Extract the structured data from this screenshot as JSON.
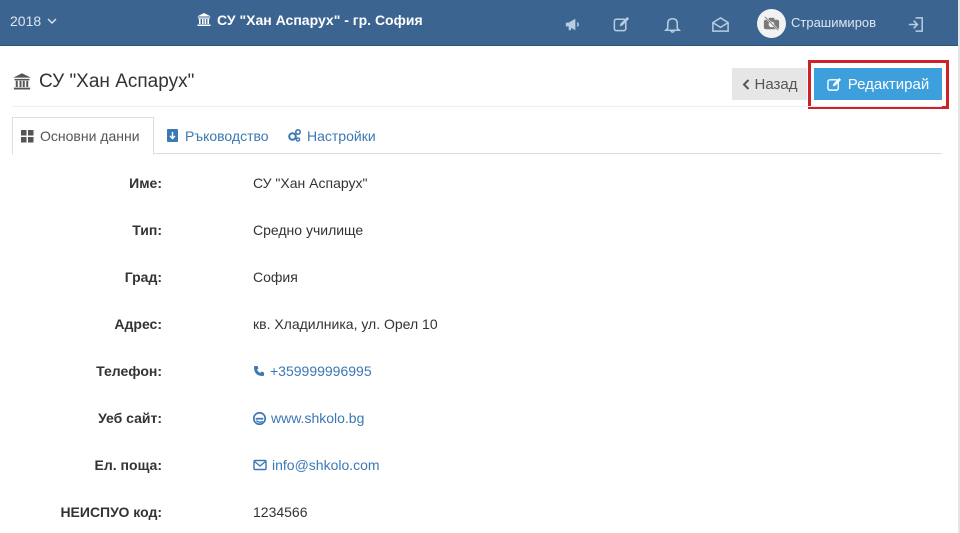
{
  "topbar": {
    "year": "2018",
    "school": "СУ \"Хан Аспарух\" - гр. София",
    "user": "Страшимиров",
    "icons": [
      "announcements-icon",
      "edit-icon",
      "bell-icon",
      "envelope-icon",
      "logout-icon"
    ]
  },
  "page": {
    "title": "СУ \"Хан Аспарух\"",
    "back_label": "Назад",
    "edit_label": "Редактирай"
  },
  "tabs": [
    {
      "label": "Основни данни",
      "icon": "grid-icon",
      "active": true
    },
    {
      "label": "Ръководство",
      "icon": "download-icon",
      "active": false
    },
    {
      "label": "Настройки",
      "icon": "cogs-icon",
      "active": false
    }
  ],
  "details": {
    "name": {
      "label": "Име:",
      "value": "СУ \"Хан Аспарух\""
    },
    "type": {
      "label": "Тип:",
      "value": "Средно училище"
    },
    "city": {
      "label": "Град:",
      "value": "София"
    },
    "address": {
      "label": "Адрес:",
      "value": "кв. Хладилника, ул. Орел 10"
    },
    "phone": {
      "label": "Телефон:",
      "value": "+359999996995"
    },
    "website": {
      "label": "Уеб сайт:",
      "value": "www.shkolo.bg"
    },
    "email": {
      "label": "Ел. поща:",
      "value": "info@shkolo.com"
    },
    "code": {
      "label": "НЕИСПУО код:",
      "value": "1234566"
    }
  },
  "colors": {
    "navbar": "#3b6590",
    "primary": "#3e9fdd",
    "link": "#3b78b4",
    "highlight": "#d0202a"
  }
}
